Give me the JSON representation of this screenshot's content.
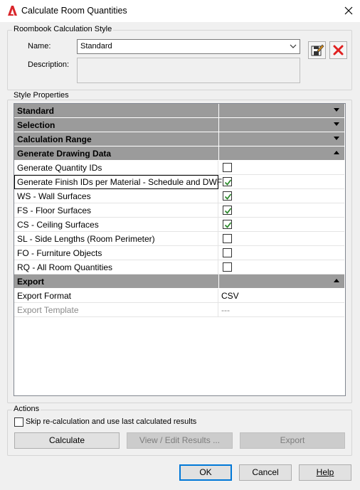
{
  "window": {
    "title": "Calculate Room Quantities",
    "close_glyph": "✕",
    "app_icon": "autocad-a-icon"
  },
  "style_group": {
    "label": "Roombook Calculation Style",
    "name_label": "Name:",
    "name_value": "Standard",
    "description_label": "Description:",
    "description_value": ""
  },
  "properties_group": {
    "label": "Style Properties",
    "categories": {
      "standard": "Standard",
      "selection": "Selection",
      "calculation_range": "Calculation Range",
      "generate_drawing_data": "Generate Drawing Data",
      "export": "Export"
    },
    "drawing_rows": [
      {
        "name": "Generate Quantity IDs",
        "checked": false
      },
      {
        "name": "Generate Finish IDs per Material - Schedule and DWF",
        "checked": true,
        "selected": true
      },
      {
        "name": "WS - Wall Surfaces",
        "checked": true
      },
      {
        "name": "FS - Floor Surfaces",
        "checked": true
      },
      {
        "name": "CS - Ceiling Surfaces",
        "checked": true
      },
      {
        "name": "SL - Side Lengths (Room Perimeter)",
        "checked": false
      },
      {
        "name": "FO - Furniture Objects",
        "checked": false
      },
      {
        "name": "RQ - All Room Quantities",
        "checked": false
      }
    ],
    "export_rows": [
      {
        "name": "Export Format",
        "value": "CSV",
        "disabled": false
      },
      {
        "name": "Export Template",
        "value": "---",
        "disabled": true
      }
    ]
  },
  "actions_group": {
    "label": "Actions",
    "skip_checkbox_label": "Skip re-calculation and use last calculated results",
    "skip_checked": false,
    "calculate_label": "Calculate",
    "view_edit_label": "View / Edit Results ...",
    "export_label": "Export"
  },
  "footer": {
    "ok_label": "OK",
    "cancel_label": "Cancel",
    "help_label": "Help"
  },
  "colors": {
    "category_bg": "#9b9b9b",
    "check_green": "#2e8b2e",
    "delete_red": "#e02020",
    "default_button_border": "#0078d7"
  }
}
